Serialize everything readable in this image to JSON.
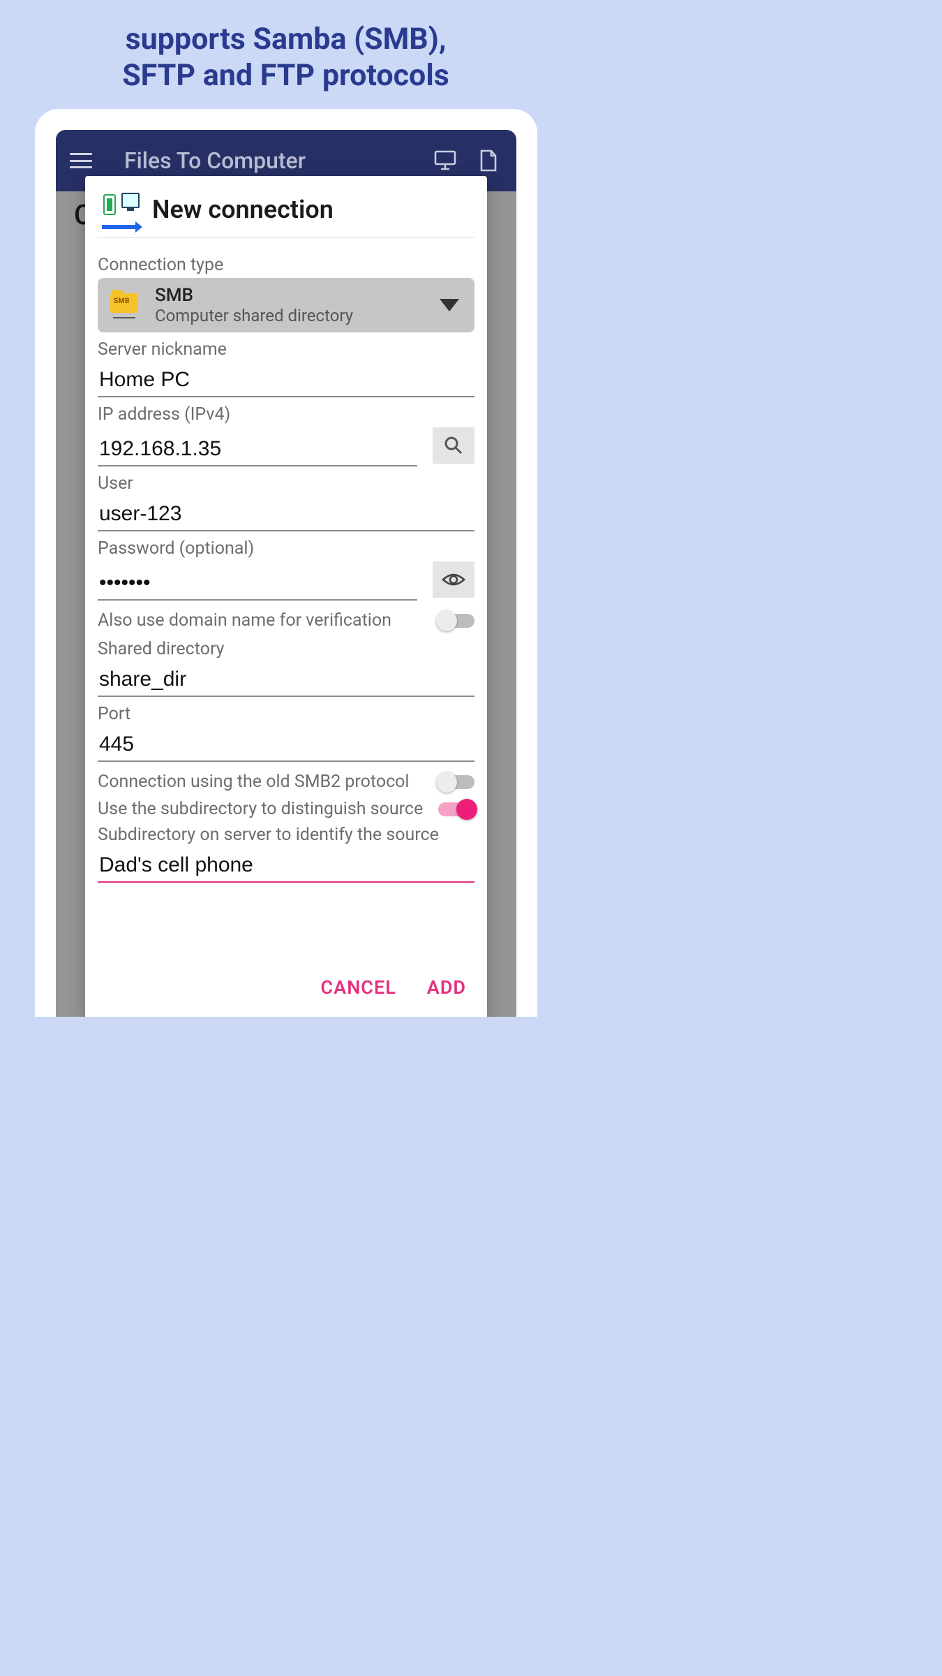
{
  "promo": {
    "line1": "supports Samba (SMB),",
    "line2": "SFTP and FTP protocols"
  },
  "appbar": {
    "title": "Files To Computer"
  },
  "background": {
    "corner_letter": "C"
  },
  "dialog": {
    "title": "New connection",
    "connection_type": {
      "label": "Connection type",
      "selected": {
        "badge": "SMB",
        "title": "SMB",
        "subtitle": "Computer shared directory"
      }
    },
    "nickname": {
      "label": "Server nickname",
      "value": "Home PC"
    },
    "ip": {
      "label": "IP address (IPv4)",
      "value": "192.168.1.35"
    },
    "user": {
      "label": "User",
      "value": "user-123"
    },
    "password": {
      "label": "Password (optional)",
      "value": "•••••••"
    },
    "domain_toggle": {
      "label": "Also use domain name for verification",
      "on": false
    },
    "shared_dir": {
      "label": "Shared directory",
      "value": "share_dir"
    },
    "port": {
      "label": "Port",
      "value": "445"
    },
    "smb2_toggle": {
      "label": "Connection using the old SMB2 protocol",
      "on": false
    },
    "subdir_toggle": {
      "label": "Use the subdirectory to distinguish source",
      "on": true
    },
    "subdir_field": {
      "label": "Subdirectory on server to identify the source",
      "value": "Dad's cell phone"
    },
    "actions": {
      "cancel": "CANCEL",
      "add": "ADD"
    }
  }
}
